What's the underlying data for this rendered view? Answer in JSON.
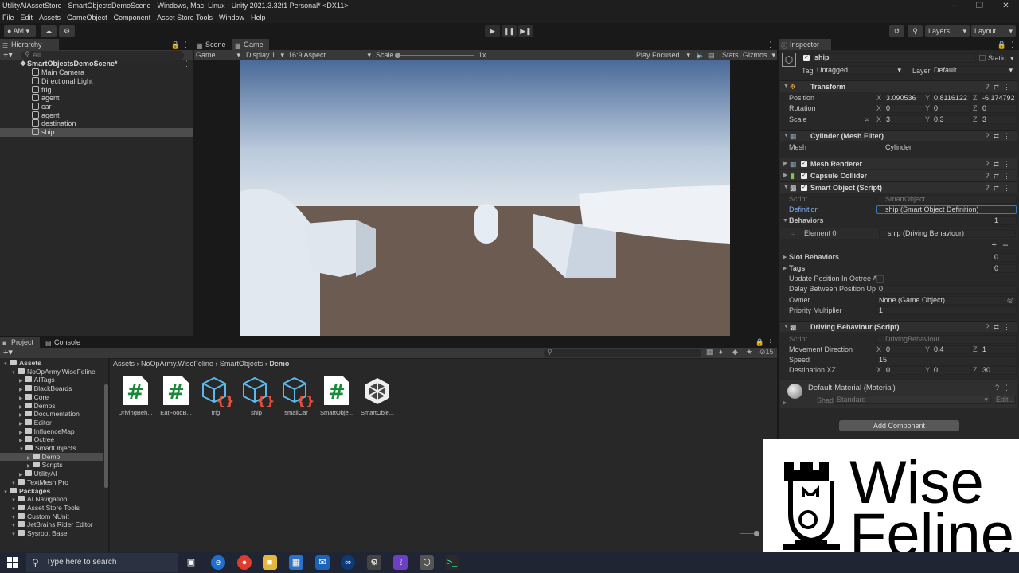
{
  "window": {
    "title": "UtilityAIAssetStore - SmartObjectsDemoScene - Windows, Mac, Linux - Unity 2021.3.32f1 Personal* <DX11>"
  },
  "menu": [
    "File",
    "Edit",
    "Assets",
    "GameObject",
    "Component",
    "Asset Store Tools",
    "Window",
    "Help"
  ],
  "toolbar": {
    "account": "AM",
    "layers": "Layers",
    "layout": "Layout"
  },
  "hierarchy": {
    "tab": "Hierarchy",
    "search_placeholder": "All",
    "scene": "SmartObjectsDemoScene*",
    "items": [
      "Main Camera",
      "Directional Light",
      "frig",
      "agent",
      "car",
      "agent",
      "destination",
      "ship"
    ],
    "selected": "ship"
  },
  "game": {
    "tabs": [
      "Scene",
      "Game"
    ],
    "mode": "Game",
    "display": "Display 1",
    "aspect": "16:9 Aspect",
    "scale_label": "Scale",
    "scale_value": "1x",
    "play_focused": "Play Focused",
    "stats": "Stats",
    "gizmos": "Gizmos"
  },
  "inspector": {
    "tab": "Inspector",
    "object_name": "ship",
    "static_label": "Static",
    "tag_label": "Tag",
    "tag_value": "Untagged",
    "layer_label": "Layer",
    "layer_value": "Default",
    "transform": {
      "title": "Transform",
      "position_label": "Position",
      "rotation_label": "Rotation",
      "scale_label": "Scale",
      "position": {
        "x": "3.090536",
        "y": "0.8116122",
        "z": "-6.174792"
      },
      "rotation": {
        "x": "0",
        "y": "0",
        "z": "0"
      },
      "scale": {
        "x": "3",
        "y": "0.3",
        "z": "3"
      }
    },
    "mesh_filter": {
      "title": "Cylinder (Mesh Filter)",
      "mesh_label": "Mesh",
      "mesh_value": "Cylinder"
    },
    "mesh_renderer": {
      "title": "Mesh Renderer"
    },
    "capsule_collider": {
      "title": "Capsule Collider"
    },
    "smart_object": {
      "title": "Smart Object (Script)",
      "script_label": "Script",
      "script_value": "SmartObject",
      "definition_label": "Definition",
      "definition_value": "ship (Smart Object Definition)",
      "behaviors_label": "Behaviors",
      "behaviors_count": "1",
      "element0_label": "Element 0",
      "element0_value": "ship (Driving Behaviour)",
      "slot_behaviors_label": "Slot Behaviors",
      "slot_behaviors_count": "0",
      "tags_label": "Tags",
      "tags_count": "0",
      "update_pos_label": "Update Position In Octree Aut",
      "delay_label": "Delay Between Position Upda",
      "delay_value": "0",
      "owner_label": "Owner",
      "owner_value": "None (Game Object)",
      "priority_label": "Priority Multiplier",
      "priority_value": "1"
    },
    "driving": {
      "title": "Driving Behaviour (Script)",
      "script_label": "Script",
      "script_value": "DrivingBehaviour",
      "movement_label": "Movement Direction",
      "movement": {
        "x": "0",
        "y": "0.4",
        "z": "1"
      },
      "speed_label": "Speed",
      "speed_value": "15",
      "dest_label": "Destination XZ",
      "dest": {
        "x": "0",
        "y": "0",
        "z": "30"
      }
    },
    "material": {
      "title": "Default-Material (Material)",
      "shader_label": "Shader",
      "shader_value": "Standard",
      "edit": "Edit..."
    },
    "add_component": "Add Component"
  },
  "project": {
    "tabs": [
      "Project",
      "Console"
    ],
    "count": "15",
    "breadcrumb": [
      "Assets",
      "NoOpArmy.WiseFeline",
      "SmartObjects",
      "Demo"
    ],
    "tree": [
      {
        "label": "Assets",
        "level": 0,
        "bold": true
      },
      {
        "label": "NoOpArmy.WiseFeline",
        "level": 1
      },
      {
        "label": "AITags",
        "level": 2
      },
      {
        "label": "BlackBoards",
        "level": 2
      },
      {
        "label": "Core",
        "level": 2
      },
      {
        "label": "Demos",
        "level": 2
      },
      {
        "label": "Documentation",
        "level": 2
      },
      {
        "label": "Editor",
        "level": 2
      },
      {
        "label": "InfluenceMap",
        "level": 2
      },
      {
        "label": "Octree",
        "level": 2
      },
      {
        "label": "SmartObjects",
        "level": 2
      },
      {
        "label": "Demo",
        "level": 3,
        "selected": true
      },
      {
        "label": "Scripts",
        "level": 3
      },
      {
        "label": "UtilityAI",
        "level": 2
      },
      {
        "label": "TextMesh Pro",
        "level": 1
      },
      {
        "label": "Packages",
        "level": 0,
        "bold": true
      },
      {
        "label": "AI Navigation",
        "level": 1
      },
      {
        "label": "Asset Store Tools",
        "level": 1
      },
      {
        "label": "Custom NUnit",
        "level": 1
      },
      {
        "label": "JetBrains Rider Editor",
        "level": 1
      },
      {
        "label": "Sysroot Base",
        "level": 1
      }
    ],
    "files": [
      {
        "name": "DrivingBeh...",
        "kind": "script"
      },
      {
        "name": "EatFoodB...",
        "kind": "script"
      },
      {
        "name": "frig",
        "kind": "so"
      },
      {
        "name": "ship",
        "kind": "so"
      },
      {
        "name": "smallCar",
        "kind": "so"
      },
      {
        "name": "SmartObje...",
        "kind": "script"
      },
      {
        "name": "SmartObje...",
        "kind": "unity"
      }
    ]
  },
  "taskbar": {
    "search_placeholder": "Type here to search"
  },
  "logo": {
    "line1": "Wise",
    "line2": "Feline"
  }
}
